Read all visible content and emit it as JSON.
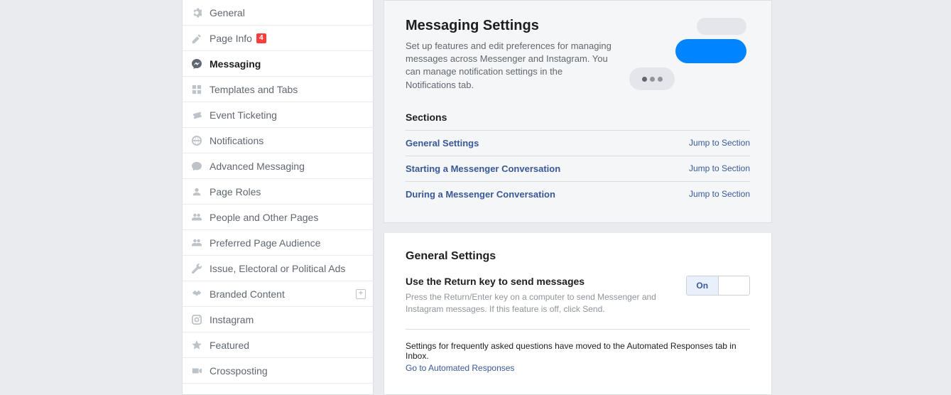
{
  "sidebar": {
    "items": [
      {
        "label": "General"
      },
      {
        "label": "Page Info",
        "badge": "4"
      },
      {
        "label": "Messaging"
      },
      {
        "label": "Templates and Tabs"
      },
      {
        "label": "Event Ticketing"
      },
      {
        "label": "Notifications"
      },
      {
        "label": "Advanced Messaging"
      },
      {
        "label": "Page Roles"
      },
      {
        "label": "People and Other Pages"
      },
      {
        "label": "Preferred Page Audience"
      },
      {
        "label": "Issue, Electoral or Political Ads"
      },
      {
        "label": "Branded Content"
      },
      {
        "label": "Instagram"
      },
      {
        "label": "Featured"
      },
      {
        "label": "Crossposting"
      }
    ]
  },
  "header": {
    "title": "Messaging Settings",
    "description": "Set up features and edit preferences for managing messages across Messenger and Instagram. You can manage notification settings in the Notifications tab."
  },
  "sections": {
    "title": "Sections",
    "link_label": "Jump to Section",
    "items": [
      {
        "name": "General Settings"
      },
      {
        "name": "Starting a Messenger Conversation"
      },
      {
        "name": "During a Messenger Conversation"
      }
    ]
  },
  "general": {
    "title": "General Settings",
    "return_key": {
      "title": "Use the Return key to send messages",
      "description": "Press the Return/Enter key on a computer to send Messenger and Instagram messages. If this feature is off, click Send.",
      "toggle_on": "On",
      "toggle_off": ""
    },
    "moved_text": "Settings for frequently asked questions have moved to the Automated Responses tab in Inbox.",
    "moved_link": "Go to Automated Responses"
  }
}
